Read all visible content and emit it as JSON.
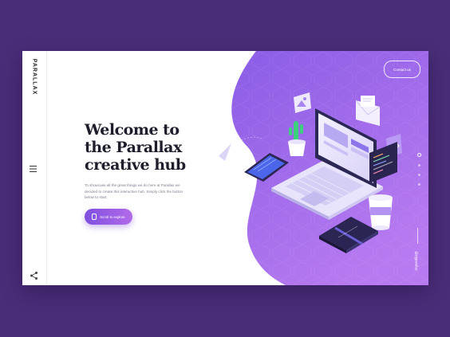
{
  "brand": {
    "logo_text": "PARALLAX"
  },
  "hero": {
    "title_line1": "Welcome to",
    "title_line2": "the Parallax",
    "title_line3": "creative hub",
    "description": "To showcase all the great things we do here at Parallax we decided to create this interactive hub. Simply click the button below to start.",
    "cta_label": "Scroll to explore"
  },
  "header": {
    "contact_label": "Contact us"
  },
  "social": {
    "handle": "@zigparallax"
  },
  "icons": {
    "menu": "hamburger-menu-icon",
    "share": "share-icon",
    "mouse": "mouse-icon"
  },
  "colors": {
    "page_bg": "#4a2d78",
    "panel_purple_top": "#8a5ce6",
    "panel_purple_bottom": "#b77af0",
    "cta_gradient_start": "#7f4fe0",
    "cta_gradient_end": "#b26be9",
    "heading": "#1d1d2b"
  },
  "pager": {
    "total": 4,
    "active_index": 1
  }
}
